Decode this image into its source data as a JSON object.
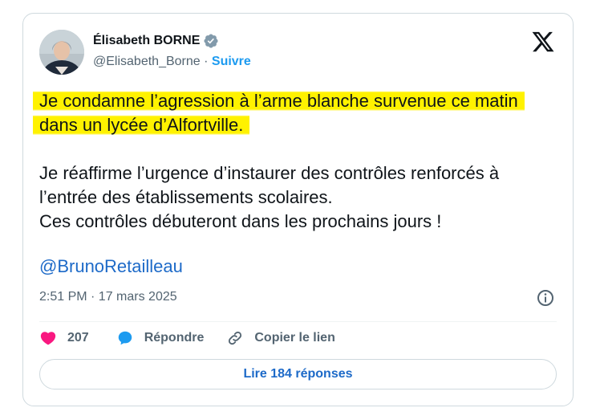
{
  "author": {
    "name": "Élisabeth BORNE",
    "handle": "@Elisabeth_Borne",
    "separator": "·",
    "follow_label": "Suivre",
    "verified_icon": "verified-badge-icon"
  },
  "tweet": {
    "highlighted_text": "Je condamne l’agression à l’arme blanche survenue ce matin dans un lycée d’Alfortville.",
    "paragraph2_line1": "Je réaffirme l’urgence d’instaurer des contrôles renforcés à l’entrée des établissements scolaires.",
    "paragraph2_line2": "Ces contrôles débuteront dans les prochains jours !",
    "mention": "@BrunoRetailleau",
    "timestamp": "2:51 PM · 17 mars 2025",
    "highlight_color": "#fff200"
  },
  "actions": {
    "like_count": "207",
    "reply_label": "Répondre",
    "copy_label": "Copier le lien"
  },
  "read_replies_label": "Lire 184 réponses",
  "colors": {
    "accent": "#1d9bf0",
    "link": "#1d6ac8",
    "like": "#f91880",
    "muted": "#536471"
  }
}
